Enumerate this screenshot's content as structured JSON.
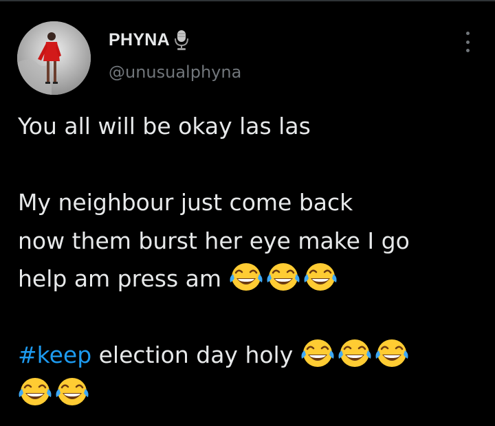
{
  "author": {
    "name": "PHYNA",
    "handle": "@unusualphyna",
    "avatar_icon": "profile-photo",
    "badge_icon": "microphone-icon"
  },
  "menu": {
    "icon": "more-options-icon"
  },
  "tweet": {
    "line1": "You all will be okay las las",
    "line2": " My neighbour just come back",
    "line3": "now them burst her eye make I go",
    "line4": "help am press am",
    "line4_emoji_count": 3,
    "hashtag": "#keep",
    "line5_rest": " election day holy",
    "line5_emoji_count": 3,
    "line6_emoji_count": 2,
    "emoji": "face-with-tears-of-joy"
  },
  "colors": {
    "background": "#000000",
    "text": "#e7e9ea",
    "secondary_text": "#71767b",
    "hashtag": "#1d9bf0"
  }
}
